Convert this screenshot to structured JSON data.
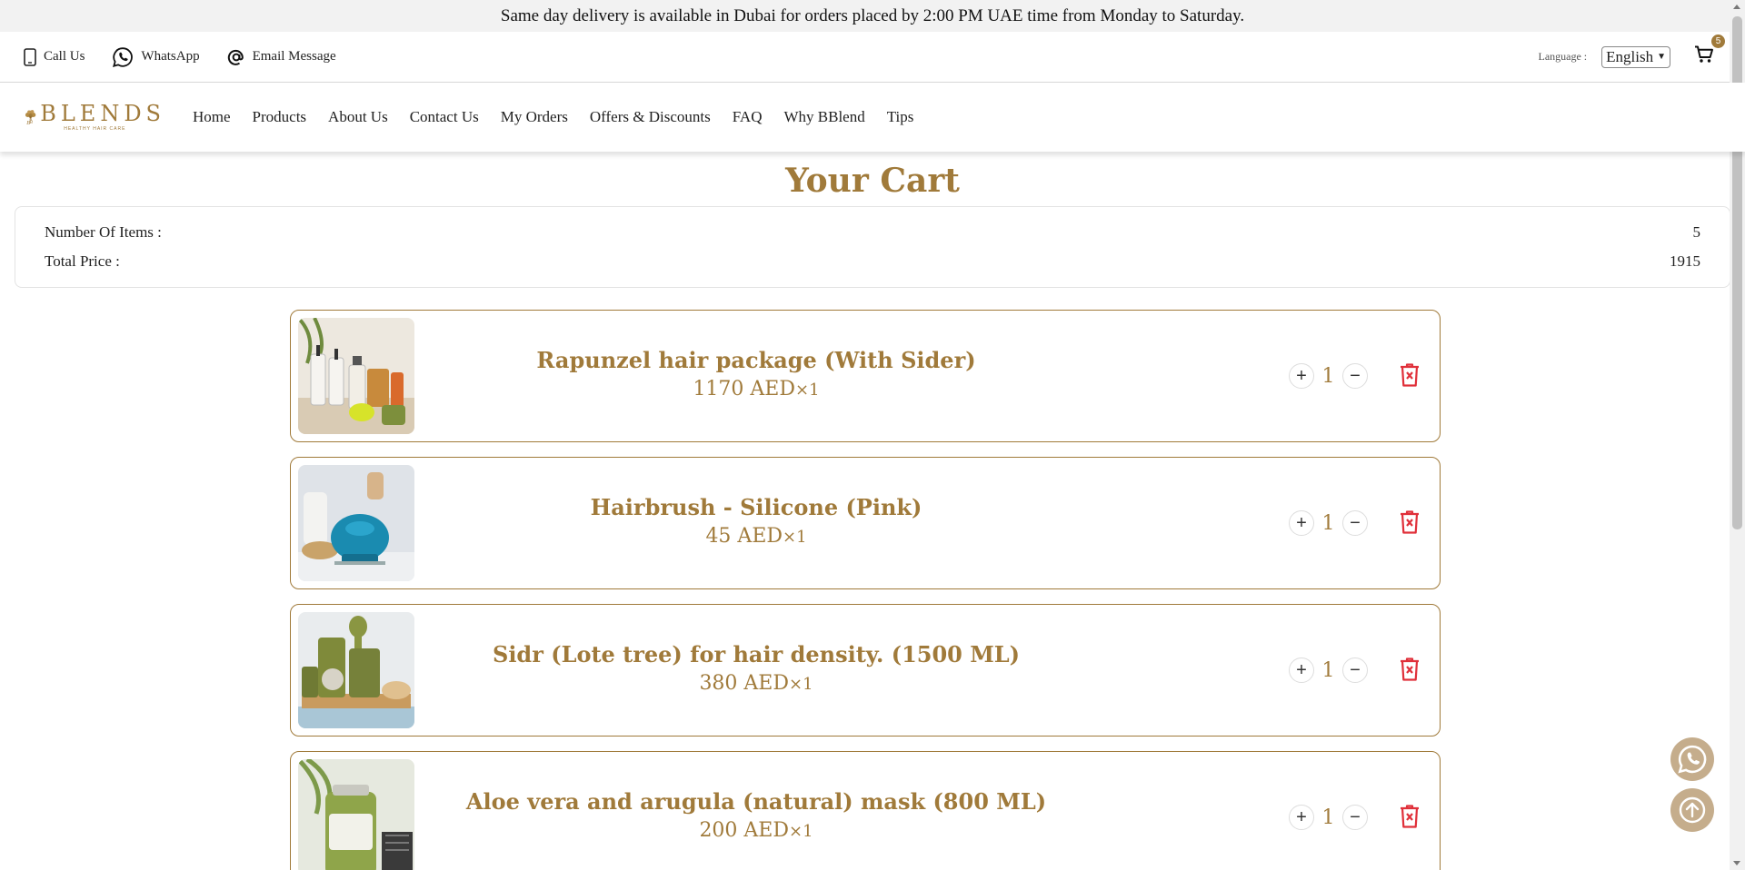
{
  "announcement": "Same day delivery is available in Dubai for orders placed by 2:00 PM UAE time from Monday to Saturday.",
  "contact": {
    "call_label": "Call Us",
    "whatsapp_label": "WhatsApp",
    "email_label": "Email Message",
    "language_label": "Language :",
    "language_value": "English",
    "cart_count": "5"
  },
  "brand": {
    "name": "BLENDS",
    "tagline": "HEALTHY HAIR CARE"
  },
  "nav": [
    "Home",
    "Products",
    "About Us",
    "Contact Us",
    "My Orders",
    "Offers & Discounts",
    "FAQ",
    "Why BBlend",
    "Tips"
  ],
  "page_title": "Your Cart",
  "summary": {
    "items_label": "Number Of Items :",
    "items_value": "5",
    "price_label": "Total Price :",
    "price_value": "1915"
  },
  "cart_items": [
    {
      "name": "Rapunzel hair package (With Sider)",
      "price": "1170 AED",
      "times": "×1",
      "qty": "1",
      "plus": "+",
      "minus": "−",
      "image": "hair-package-bottles-image"
    },
    {
      "name": "Hairbrush - Silicone (Pink)",
      "price": "45 AED",
      "times": "×1",
      "qty": "1",
      "plus": "+",
      "minus": "−",
      "image": "silicone-hairbrush-image"
    },
    {
      "name": "Sidr (Lote tree) for hair density. (1500 ML)",
      "price": "380 AED",
      "times": "×1",
      "qty": "1",
      "plus": "+",
      "minus": "−",
      "image": "sidr-jars-image"
    },
    {
      "name": "Aloe vera and arugula (natural) mask (800 ML)",
      "price": "200 AED",
      "times": "×1",
      "qty": "1",
      "plus": "+",
      "minus": "−",
      "image": "aloe-mask-jar-image"
    }
  ],
  "colors": {
    "accent": "#a07a3a",
    "danger": "#e0303a",
    "float_button": "#c5ad8c"
  }
}
